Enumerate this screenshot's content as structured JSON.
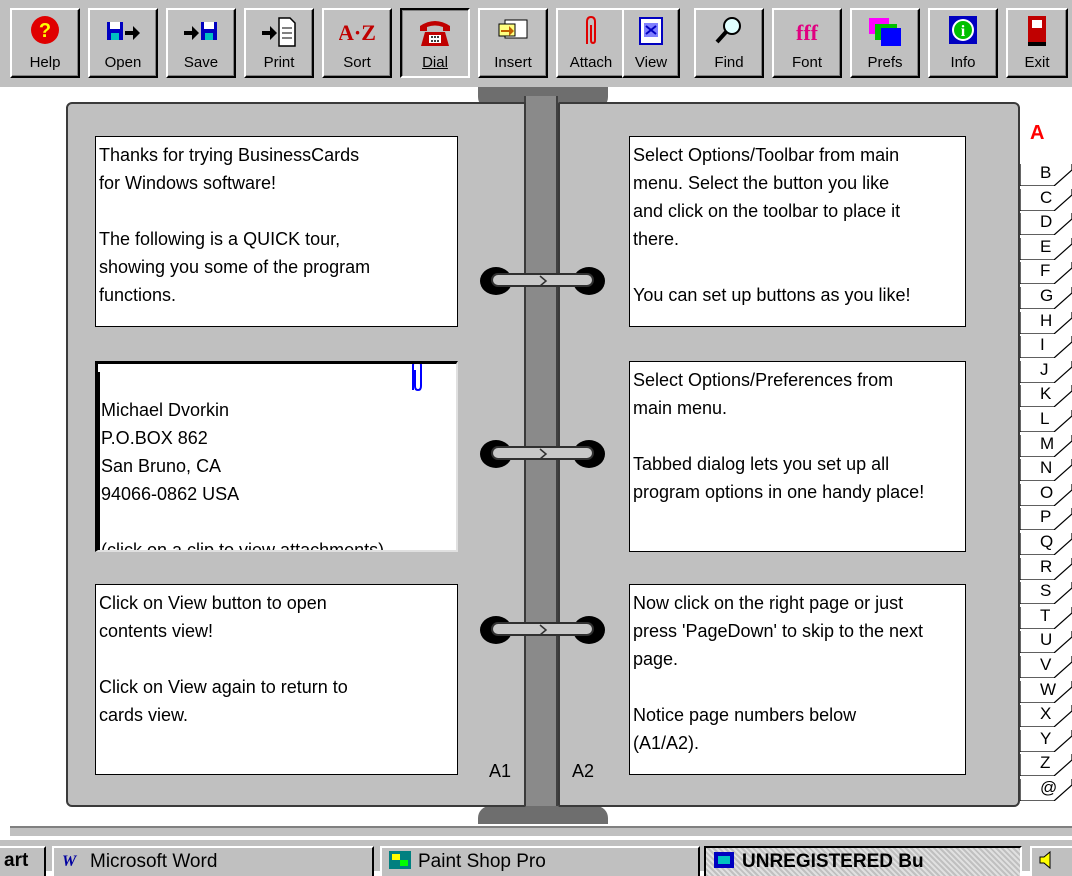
{
  "toolbar": {
    "buttons": [
      {
        "label": "Help",
        "icon": "help-icon"
      },
      {
        "label": "Open",
        "icon": "open-icon"
      },
      {
        "label": "Save",
        "icon": "save-icon"
      },
      {
        "label": "Print",
        "icon": "print-icon"
      },
      {
        "label": "Sort",
        "icon": "sort-icon",
        "icon_text": "A·Z"
      },
      {
        "label": "Dial",
        "icon": "phone-icon",
        "pressed": true
      },
      {
        "label": "Insert",
        "icon": "insert-icon"
      },
      {
        "label": "Attach",
        "icon": "paperclip-icon"
      },
      {
        "label": "View",
        "icon": "view-icon"
      },
      {
        "label": "Find",
        "icon": "magnifier-icon"
      },
      {
        "label": "Font",
        "icon": "font-icon",
        "icon_text": "fff"
      },
      {
        "label": "Prefs",
        "icon": "prefs-icon"
      },
      {
        "label": "Info",
        "icon": "info-icon"
      },
      {
        "label": "Exit",
        "icon": "exit-icon"
      }
    ]
  },
  "left_page": {
    "number": "A1",
    "cards": [
      {
        "text": "Thanks for trying BusinessCards\nfor Windows software!\n\nThe following is a QUICK tour,\nshowing you some of the program\nfunctions."
      },
      {
        "text": "Michael Dvorkin\nP.O.BOX 862\nSan Bruno, CA\n94066-0862 USA\n\n(click on a clip to view attachments)",
        "has_attachment": true
      },
      {
        "text": "Click on View button to open\ncontents view!\n\nClick on View again to return to\ncards view."
      }
    ]
  },
  "right_page": {
    "number": "A2",
    "cards": [
      {
        "text": "Select Options/Toolbar from main\nmenu. Select the button you like\nand click on the toolbar to place it\nthere.\n\nYou can set up buttons  as you like!"
      },
      {
        "text": "Select Options/Preferences from\nmain menu.\n\nTabbed dialog lets you set up all\nprogram options in one handy place!"
      },
      {
        "text": "Now click on the right page or just\npress 'PageDown' to skip to the next\npage.\n\nNotice page numbers below\n(A1/A2)."
      }
    ]
  },
  "index": {
    "active": "A",
    "letters": [
      "B",
      "C",
      "D",
      "E",
      "F",
      "G",
      "H",
      "I",
      "J",
      "K",
      "L",
      "M",
      "N",
      "O",
      "P",
      "Q",
      "R",
      "S",
      "T",
      "U",
      "V",
      "W",
      "X",
      "Y",
      "Z",
      "@"
    ]
  },
  "taskbar": {
    "start_label": "art",
    "tasks": [
      {
        "label": "Microsoft Word",
        "icon": "word-icon"
      },
      {
        "label": "Paint Shop Pro",
        "icon": "paint-shop-pro-icon"
      },
      {
        "label": "UNREGISTERED  Bu",
        "icon": "businesscards-icon",
        "active": true
      }
    ]
  },
  "colors": {
    "face": "#c0c0c0",
    "active_letter": "#ff0000",
    "help_red": "#e00000",
    "blue": "#0000c0"
  }
}
